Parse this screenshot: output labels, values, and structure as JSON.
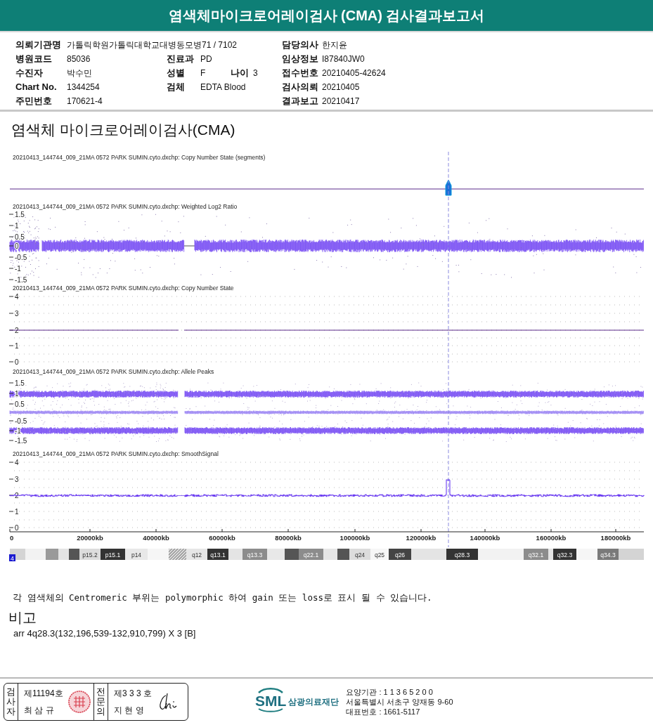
{
  "title": "염색체마이크로어레이검사 (CMA) 검사결과보고서",
  "info_rows": [
    {
      "left": {
        "label": "의뢰기관명",
        "value": "가톨릭학원가톨릭대학교대병동모병71 / 7102"
      },
      "right": {
        "label": "담당의사",
        "value": "한지윤"
      }
    },
    {
      "left": {
        "label": "병원코드",
        "value": "85036"
      },
      "middle": [
        {
          "label": "진료과",
          "value": "PD"
        }
      ],
      "right": {
        "label": "임상정보",
        "value": "I87840JW0"
      }
    },
    {
      "left": {
        "label": "수진자",
        "value": "박수민"
      },
      "middle": [
        {
          "label": "성별",
          "value": "F"
        },
        {
          "label": "나이",
          "value": "3"
        }
      ],
      "right": {
        "label": "접수번호",
        "value": "20210405-42624"
      }
    },
    {
      "left": {
        "label": "Chart No.",
        "value": "1344254"
      },
      "middle": [
        {
          "label": "검체",
          "value": "EDTA Blood"
        }
      ],
      "right": {
        "label": "검사의뢰",
        "value": "20210405"
      }
    },
    {
      "left": {
        "label": "주민번호",
        "value": "170621-4"
      },
      "right": {
        "label": "결과보고",
        "value": "20210417"
      }
    }
  ],
  "section_title": "염색체 마이크로어레이검사(CMA)",
  "panels": [
    {
      "kind": "segments",
      "title": "20210413_144744_009_21MA 0572 PARK SUMIN.cyto.dxchp: Copy Number State (segments)"
    },
    {
      "kind": "log2",
      "title": "20210413_144744_009_21MA 0572 PARK SUMIN.cyto.dxchp: Weighted Log2 Ratio",
      "yticks": [
        "1.5",
        "1",
        "0.5",
        "0",
        "-0.5",
        "-1",
        "-1.5"
      ]
    },
    {
      "kind": "cns",
      "title": "20210413_144744_009_21MA 0572 PARK SUMIN.cyto.dxchp: Copy Number State",
      "yticks": [
        "4",
        "3",
        "2",
        "1",
        "0"
      ]
    },
    {
      "kind": "allele",
      "title": "20210413_144744_009_21MA 0572 PARK SUMIN.cyto.dxchp: Allele Peaks",
      "yticks": [
        "1.5",
        "1",
        "0.5",
        "-0.5",
        "-1",
        "-1.5"
      ]
    },
    {
      "kind": "smooth",
      "title": "20210413_144744_009_21MA 0572 PARK SUMIN.cyto.dxchp: SmoothSignal",
      "yticks": [
        "4",
        "3",
        "2",
        "1",
        "0"
      ]
    }
  ],
  "x_axis_labels": [
    "0",
    "20000kb",
    "40000kb",
    "60000kb",
    "80000kb",
    "100000kb",
    "120000kb",
    "140000kb",
    "160000kb",
    "180000kb"
  ],
  "ideogram": {
    "chromosome": "4",
    "bands": [
      {
        "color": "#d4d4d4"
      },
      {
        "color": "#f2f2f2"
      },
      {
        "color": "#9a9a9a"
      },
      {
        "color": "#e4e4e4"
      },
      {
        "color": "#555555"
      },
      {
        "label": "p15.2",
        "color": "#dcdcdc"
      },
      {
        "label": "p15.1",
        "color": "#333333"
      },
      {
        "label": "p14",
        "color": "#e8e8e8"
      },
      {
        "color": "#f6f6f6"
      },
      {
        "kind": "centromere"
      },
      {
        "label": "q12",
        "color": "#e6e6e6"
      },
      {
        "label": "q13.1",
        "color": "#333333"
      },
      {
        "color": "#e4e4e4"
      },
      {
        "label": "q13.3",
        "color": "#8c8c8c"
      },
      {
        "color": "#e8e8e8"
      },
      {
        "color": "#555555"
      },
      {
        "label": "q22.1",
        "color": "#8c8c8c"
      },
      {
        "color": "#e6e6e6"
      },
      {
        "color": "#555555"
      },
      {
        "label": "q24",
        "color": "#dcdcdc"
      },
      {
        "label": "q25",
        "color": "#f6f6f6"
      },
      {
        "label": "q26",
        "color": "#444444"
      },
      {
        "color": "#e4e4e4"
      },
      {
        "label": "q28.3",
        "color": "#333333"
      },
      {
        "color": "#f2f2f2"
      },
      {
        "label": "q32.1",
        "color": "#8c8c8c"
      },
      {
        "color": "#e4e4e4"
      },
      {
        "label": "q32.3",
        "color": "#333333"
      },
      {
        "color": "#f6f6f6"
      },
      {
        "label": "q34.3",
        "color": "#7a7a7a"
      },
      {
        "color": "#d4d4d4"
      }
    ]
  },
  "note": "각 염색체의 Centromeric 부위는 polymorphic 하여 gain 또는 loss로 표시 될 수 있습니다.",
  "remarks_title": "비고",
  "remarks": "arr 4q28.3(132,196,539-132,910,799) X 3 [B]",
  "signers": [
    {
      "role": "검사자",
      "number": "제11194호",
      "name": "최 삼 규",
      "kind": "seal"
    },
    {
      "role": "전문의",
      "number": "제3 3 3 호",
      "name": "지 현 영",
      "kind": "signature"
    }
  ],
  "logo": {
    "mark": "SML",
    "name": "삼광의료재단"
  },
  "contact": [
    "요양기관 : 1 1 3 6 5 2 0 0",
    "서울특별시 서초구 양재동 9-60",
    "대표번호 : 1661-5117"
  ]
}
